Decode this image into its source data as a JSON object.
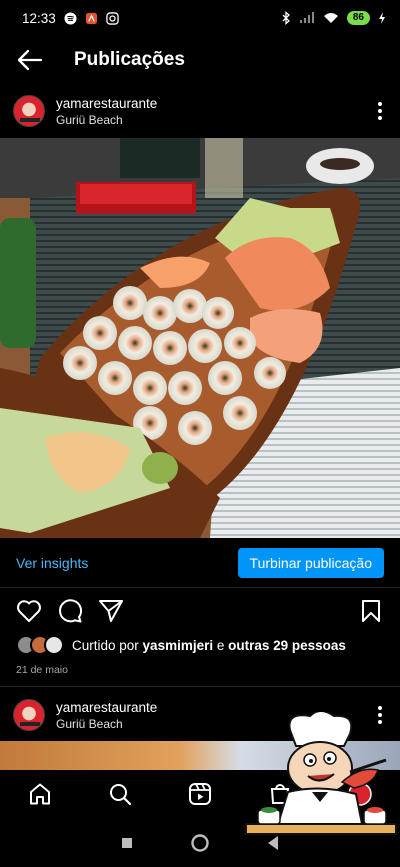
{
  "status_bar": {
    "time": "12:33",
    "battery": "86"
  },
  "header": {
    "title": "Publicações"
  },
  "post": {
    "username": "yamarestaurante",
    "location": "Guriü Beach",
    "insights_label": "Ver insights",
    "boost_label": "Turbinar publicação",
    "likes": {
      "prefix": "Curtido por ",
      "user": "yasmimjeri",
      "middle": " e ",
      "others": "outras 29 pessoas"
    },
    "date": "21 de maio"
  },
  "next_post": {
    "username": "yamarestaurante",
    "location": "Guriü Beach"
  },
  "bottom_nav": [
    "home-icon",
    "search-icon",
    "reels-icon",
    "shop-icon",
    "profile-icon"
  ],
  "colors": {
    "link": "#4cb5f9",
    "primary_button": "#0095f6",
    "battery": "#7adb4b",
    "background": "#000000"
  }
}
